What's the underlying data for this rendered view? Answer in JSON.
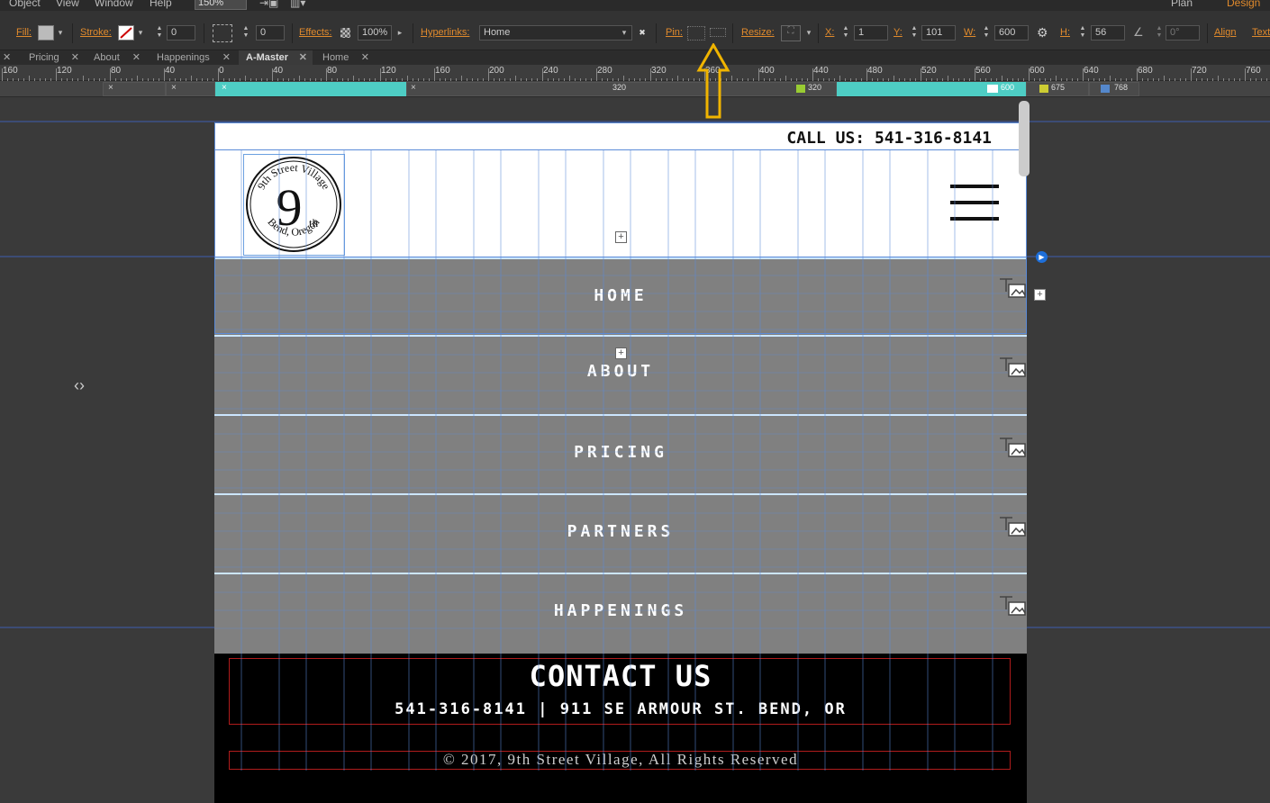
{
  "menubar": {
    "items": [
      "Object",
      "View",
      "Window",
      "Help"
    ],
    "zoom": "150%",
    "workspace_plan": "Plan",
    "workspace_design": "Design"
  },
  "controlbar": {
    "fill_label": "Fill:",
    "stroke_label": "Stroke:",
    "stroke_width": "0",
    "corner_radius": "0",
    "effects_label": "Effects:",
    "effects_opacity": "100%",
    "hyperlinks_label": "Hyperlinks:",
    "hyperlink_value": "Home",
    "pin_label": "Pin:",
    "resize_label": "Resize:",
    "x_label": "X:",
    "x_value": "1",
    "y_label": "Y:",
    "y_value": "101",
    "w_label": "W:",
    "w_value": "600",
    "h_label": "H:",
    "h_value": "56",
    "rotation": "0°",
    "align_label": "Align",
    "text_label": "Text"
  },
  "tabs": [
    {
      "label": "Pricing"
    },
    {
      "label": "About"
    },
    {
      "label": "Happenings"
    },
    {
      "label": "A-Master"
    },
    {
      "label": "Home"
    }
  ],
  "ruler": {
    "labels": [
      "160",
      "120",
      "80",
      "40",
      "0",
      "40",
      "80",
      "120",
      "160",
      "200",
      "240",
      "280",
      "320",
      "360",
      "400",
      "440",
      "480",
      "520",
      "560",
      "600",
      "640",
      "680",
      "720",
      "760"
    ]
  },
  "breakpoints": {
    "center_value": "320",
    "bp1": "320",
    "bp2": "600",
    "bp3": "675",
    "bp4": "768",
    "active_color": "#4ecdc4"
  },
  "site": {
    "call_us": "CALL US: 541-316-8141",
    "nav": [
      "HOME",
      "ABOUT",
      "PRICING",
      "PARTNERS",
      "HAPPENINGS"
    ],
    "contact_title": "CONTACT US",
    "contact_info": "541-316-8141 | 911 SE ARMOUR ST. BEND, OR",
    "copyright": "© 2017, 9th Street Village, All Rights Reserved",
    "logo_text_top": "9th Street Village",
    "logo_text_bottom": "Bend, Oregon",
    "logo_numeral": "9",
    "logo_suffix": "th",
    "nav_color": "#808080",
    "footer_color": "#000000"
  },
  "colors": {
    "accent_orange": "#e08a2c",
    "guide_blue": "#5b8bd8",
    "arrow_yellow": "#f0b400"
  }
}
